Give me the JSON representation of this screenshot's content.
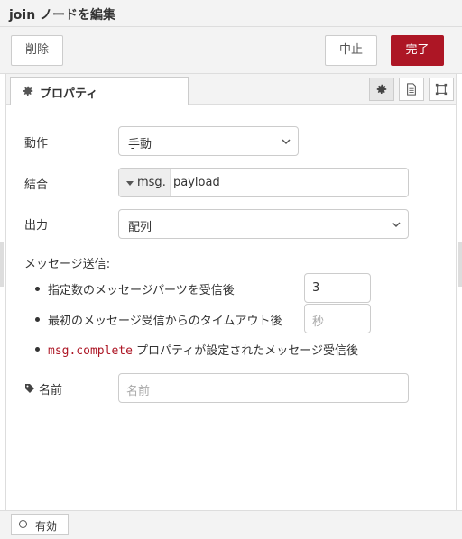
{
  "dialog": {
    "title": "join ノードを編集"
  },
  "toolbar": {
    "delete_label": "削除",
    "cancel_label": "中止",
    "done_label": "完了"
  },
  "tabs": {
    "properties_label": "プロパティ"
  },
  "form": {
    "mode": {
      "label": "動作",
      "value": "手動"
    },
    "combine": {
      "label": "結合",
      "type": "msg.",
      "value": "payload"
    },
    "output": {
      "label": "出力",
      "value": "配列"
    },
    "send": {
      "heading": "メッセージ送信:",
      "count_label": "指定数のメッセージパーツを受信後",
      "count_value": "3",
      "timeout_label": "最初のメッセージ受信からのタイムアウト後",
      "timeout_placeholder": "秒",
      "complete_code": "msg.complete",
      "complete_label": " プロパティが設定されたメッセージ受信後"
    },
    "name": {
      "label": "名前",
      "placeholder": "名前"
    }
  },
  "footer": {
    "enable_label": "有効"
  },
  "colors": {
    "primary": "#ad1625",
    "toolbar_bg": "#f3f3f3",
    "border": "#cccccc"
  }
}
